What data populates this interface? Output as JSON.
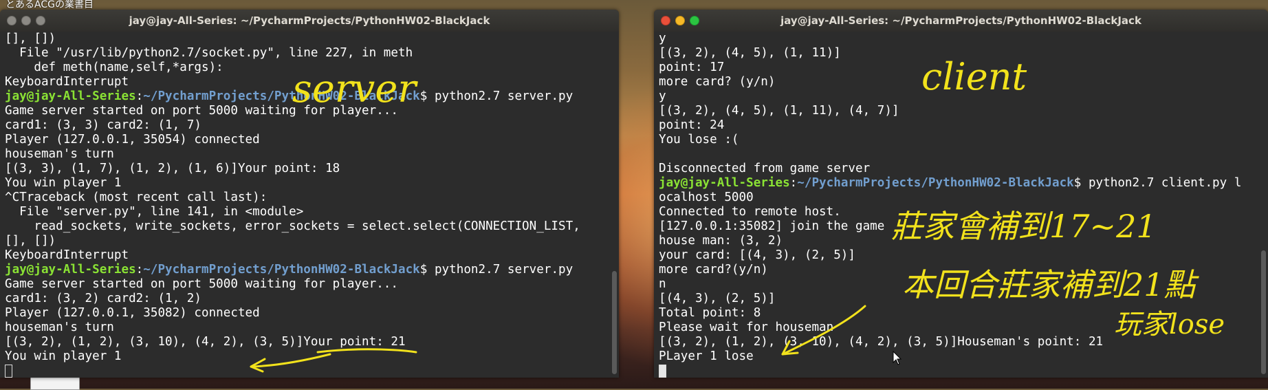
{
  "desktop": {
    "label": "とあるACGの業書目"
  },
  "server_window": {
    "title": "jay@jay-All-Series: ~/PycharmProjects/PythonHW02-BlackJack",
    "lines": [
      {
        "type": "text",
        "text": "[], [])"
      },
      {
        "type": "text",
        "text": "  File \"/usr/lib/python2.7/socket.py\", line 227, in meth"
      },
      {
        "type": "text",
        "text": "    def meth(name,self,*args):"
      },
      {
        "type": "text",
        "text": "KeyboardInterrupt"
      },
      {
        "type": "prompt",
        "user": "jay@jay-All-Series",
        "path": "~/PycharmProjects/PythonHW02-BlackJack",
        "cmd": "$ python2.7 server.py"
      },
      {
        "type": "text",
        "text": "Game server started on port 5000 waiting for player..."
      },
      {
        "type": "text",
        "text": "card1: (3, 3) card2: (1, 7)"
      },
      {
        "type": "text",
        "text": "Player (127.0.0.1, 35054) connected"
      },
      {
        "type": "text",
        "text": "houseman's turn"
      },
      {
        "type": "text",
        "text": "[(3, 3), (1, 7), (1, 2), (1, 6)]Your point: 18"
      },
      {
        "type": "text",
        "text": "You win player 1"
      },
      {
        "type": "text",
        "text": "^CTraceback (most recent call last):"
      },
      {
        "type": "text",
        "text": "  File \"server.py\", line 141, in <module>"
      },
      {
        "type": "text",
        "text": "    read_sockets, write_sockets, error_sockets = select.select(CONNECTION_LIST,"
      },
      {
        "type": "text",
        "text": "[], [])"
      },
      {
        "type": "text",
        "text": "KeyboardInterrupt"
      },
      {
        "type": "prompt",
        "user": "jay@jay-All-Series",
        "path": "~/PycharmProjects/PythonHW02-BlackJack",
        "cmd": "$ python2.7 server.py"
      },
      {
        "type": "text",
        "text": "Game server started on port 5000 waiting for player..."
      },
      {
        "type": "text",
        "text": "card1: (3, 2) card2: (1, 2)"
      },
      {
        "type": "text",
        "text": "Player (127.0.0.1, 35082) connected"
      },
      {
        "type": "text",
        "text": "houseman's turn"
      },
      {
        "type": "text",
        "text": "[(3, 2), (1, 2), (3, 10), (4, 2), (3, 5)]Your point: 21"
      },
      {
        "type": "text",
        "text": "You win player 1"
      },
      {
        "type": "cursor"
      }
    ],
    "annotation": "server"
  },
  "client_window": {
    "title": "jay@jay-All-Series: ~/PycharmProjects/PythonHW02-BlackJack",
    "lines": [
      {
        "type": "text",
        "text": "y"
      },
      {
        "type": "text",
        "text": "[(3, 2), (4, 5), (1, 11)]"
      },
      {
        "type": "text",
        "text": "point: 17"
      },
      {
        "type": "text",
        "text": "more card? (y/n)"
      },
      {
        "type": "text",
        "text": "y"
      },
      {
        "type": "text",
        "text": "[(3, 2), (4, 5), (1, 11), (4, 7)]"
      },
      {
        "type": "text",
        "text": "point: 24"
      },
      {
        "type": "text",
        "text": "You lose :("
      },
      {
        "type": "text",
        "text": ""
      },
      {
        "type": "text",
        "text": "Disconnected from game server"
      },
      {
        "type": "prompt",
        "user": "jay@jay-All-Series",
        "path": "~/PycharmProjects/PythonHW02-BlackJack",
        "cmd": "$ python2.7 client.py l"
      },
      {
        "type": "text",
        "text": "ocalhost 5000"
      },
      {
        "type": "text",
        "text": "Connected to remote host."
      },
      {
        "type": "text",
        "text": "[127.0.0.1:35082] join the game"
      },
      {
        "type": "text",
        "text": "house man: (3, 2)"
      },
      {
        "type": "text",
        "text": "your card: [(4, 3), (2, 5)]"
      },
      {
        "type": "text",
        "text": "more card?(y/n)"
      },
      {
        "type": "text",
        "text": "n"
      },
      {
        "type": "text",
        "text": "[(4, 3), (2, 5)]"
      },
      {
        "type": "text",
        "text": "Total point: 8"
      },
      {
        "type": "text",
        "text": "Please wait for houseman"
      },
      {
        "type": "text",
        "text": "[(3, 2), (1, 2), (3, 10), (4, 2), (3, 5)]Houseman's point: 21"
      },
      {
        "type": "text",
        "text": "PLayer 1 lose"
      },
      {
        "type": "cursor"
      }
    ],
    "annotations": [
      "client",
      "莊家會補到17~21",
      "本回合莊家補到21點",
      "玩家lose"
    ]
  },
  "colors": {
    "terminal_bg": "#2c2c2c",
    "prompt_user": "#8ae234",
    "prompt_path": "#729fcf",
    "annotation_ink": "#f2e21c"
  }
}
